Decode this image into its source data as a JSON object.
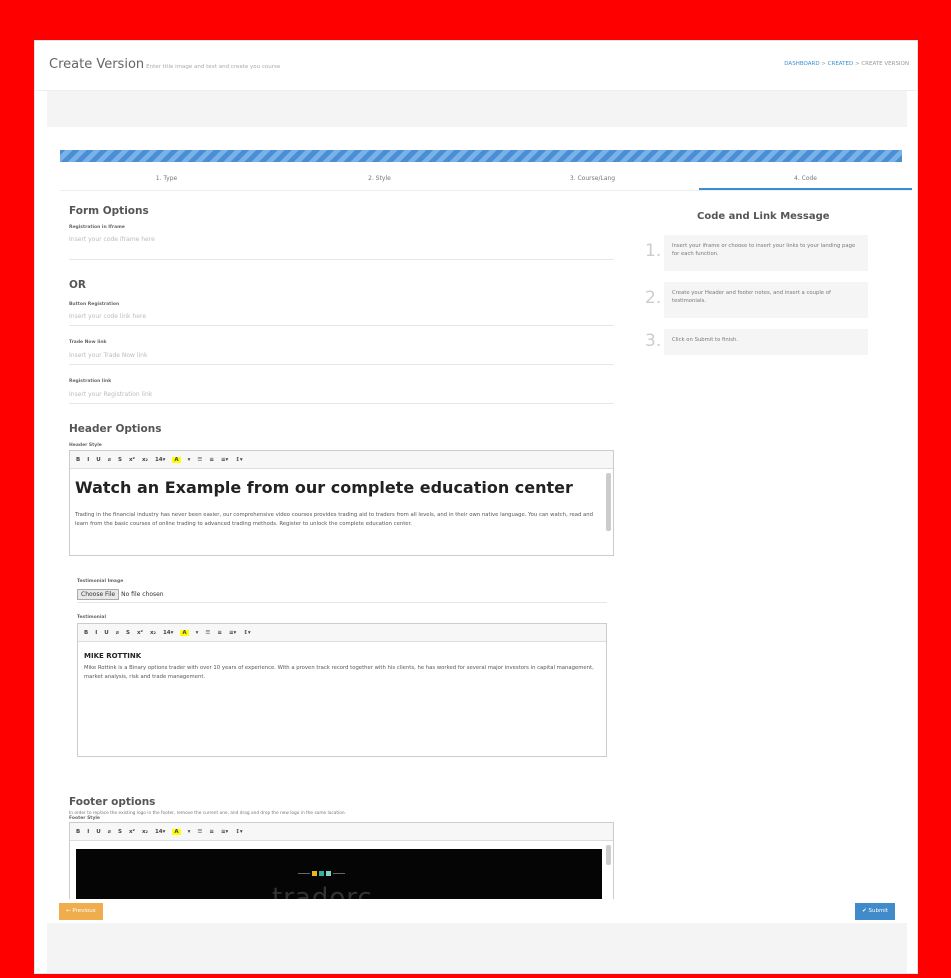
{
  "header": {
    "title": "Create Version",
    "subtitle": "Enter title image and text and create you course",
    "breadcrumb": [
      "DASHBOARD",
      ">",
      "CREATED",
      ">",
      "CREATE VERSION"
    ]
  },
  "steps": [
    {
      "label": "1. Type"
    },
    {
      "label": "2. Style"
    },
    {
      "label": "3. Course/Lang"
    },
    {
      "label": "4. Code"
    }
  ],
  "form": {
    "form_options_title": "Form Options",
    "iframe_label": "Registration in Iframe",
    "iframe_placeholder": "Insert your code iframe here",
    "or_label": "OR",
    "button_reg_label": "Button Registration",
    "button_reg_placeholder": "Insert your code link here",
    "trade_now_label": "Trade Now link",
    "trade_now_placeholder": "Insert your Trade Now link",
    "reg_link_label": "Registration link",
    "reg_link_placeholder": "Insert your Registration link",
    "header_options_title": "Header Options",
    "header_style_label": "Header Style",
    "header_heading": "Watch an Example from our complete education center",
    "header_paragraph": "Trading in the financial industry has never been easier, our comprehensive video courses provides trading aid to traders from all levels, and in their own native language. You can watch, read and learn from the basic courses of online trading to advanced trading methods. Register to unlock the complete education center.",
    "testimonial_image_label": "Testimonial Image",
    "choose_file": "Choose File",
    "no_file": "No file chosen",
    "testimonial_label": "Testimonial",
    "testimonial_name": "MIKE ROTTINK",
    "testimonial_text": "Mike Rottink is a Binary options trader with over 10 years of experience. With a proven track record together with his clients, he has worked for several major investors in capital management, market analysis, risk and trade management.",
    "footer_options_title": "Footer options",
    "footer_hint": "In order to replace the existing logo in the footer, remove the current one, and drag and drop the new logo in the same location.",
    "footer_style_label": "Footer Style",
    "footer_logo_text": "tradorc"
  },
  "toolbar": [
    "B",
    "I",
    "U",
    "⌀",
    "S",
    "x²",
    "x₂",
    "14▾",
    "A",
    "▾",
    "☰",
    "≡",
    "≡▾",
    "↕▾"
  ],
  "help": {
    "title": "Code and Link Message",
    "items": [
      {
        "num": "1.",
        "text": "Insert your iframe or choose to insert your links to your landing page for each function."
      },
      {
        "num": "2.",
        "text": "Create your Header and footer notes, and insert a couple of testimonials."
      },
      {
        "num": "3.",
        "text": "Click on Submit to finish."
      }
    ]
  },
  "actions": {
    "previous": "← Previous",
    "submit": "✔ Submit"
  },
  "colors": {
    "frame": "#ff0000",
    "accent": "#3b8fd0",
    "previous": "#f0ad4e",
    "submit": "#428bca",
    "highlight": "#ffff00"
  }
}
